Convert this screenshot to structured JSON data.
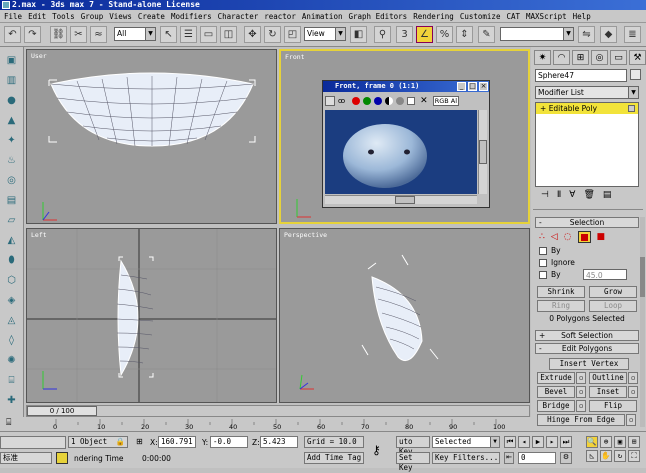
{
  "window": {
    "title": "2.max - 3ds max 7 - Stand-alone License"
  },
  "menu": [
    "File",
    "Edit",
    "Tools",
    "Group",
    "Views",
    "Create",
    "Modifiers",
    "Character",
    "reactor",
    "Animation",
    "Graph Editors",
    "Rendering",
    "Customize",
    "CAT",
    "MAXScript",
    "Help"
  ],
  "toolbar": {
    "selection_filter": "All",
    "ref_coord": "View"
  },
  "viewports": {
    "top_left": "User",
    "top_right": "Front",
    "bottom_left": "Left",
    "bottom_right": "Perspective"
  },
  "render_window": {
    "title": "Front, frame 0 (1:1)",
    "channel": "RGB Al"
  },
  "panel": {
    "object_name": "Sphere47",
    "modifier_list": "Modifier List",
    "stack_item": "Editable Poly",
    "selection_title": "Selection",
    "by_vertex": "By",
    "ignore": "Ignore",
    "by_angle": "By",
    "angle_value": "45.0",
    "shrink": "Shrink",
    "grow": "Grow",
    "ring": "Ring",
    "loop": "Loop",
    "selected_info": "0 Polygons Selected",
    "soft_selection": "Soft Selection",
    "edit_polygons": "Edit Polygons",
    "insert_vertex": "Insert Vertex",
    "extrude": "Extrude",
    "outline": "Outline",
    "bevel": "Bevel",
    "inset": "Inset",
    "bridge": "Bridge",
    "flip": "Flip",
    "hinge": "Hinge From Edge"
  },
  "timeline": {
    "frame": "0 / 100",
    "ticks": [
      "0",
      "10",
      "20",
      "30",
      "40",
      "50",
      "60",
      "70",
      "80",
      "90",
      "100"
    ]
  },
  "status": {
    "objects": "1 Object",
    "x_label": "X:",
    "x": "160.791",
    "y_label": "Y:",
    "y": "-0.0",
    "z_label": "Z:",
    "z": "5.423",
    "grid": "Grid = 10.0",
    "auto_key": "uto Key",
    "key_mode": "Selected",
    "set_key": "Set Key",
    "key_filters": "Key Filters...",
    "lang": "标准",
    "render_time": "ndering Time",
    "time": "0:00:00",
    "add_time_tag": "Add Time Tag",
    "frame": "0"
  }
}
